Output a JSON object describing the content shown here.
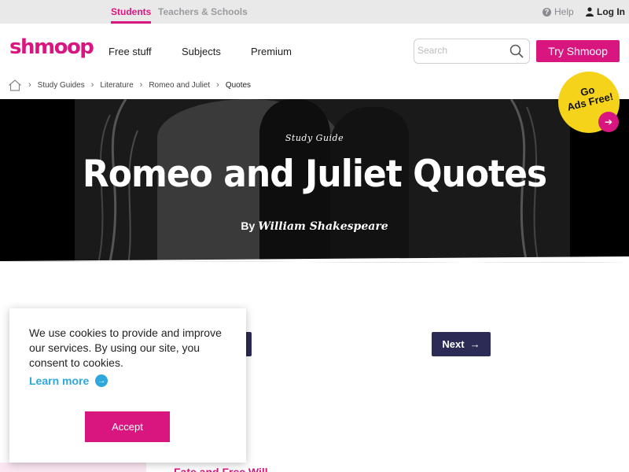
{
  "topbar": {
    "students_tab": "Students",
    "teachers_tab": "Teachers & Schools",
    "help": "Help",
    "login": "Log In"
  },
  "header": {
    "logo": "shmoop",
    "nav": [
      "Free stuff",
      "Subjects",
      "Premium"
    ],
    "search_placeholder": "Search",
    "try_button": "Try Shmoop"
  },
  "breadcrumb": {
    "items": [
      "Study Guides",
      "Literature",
      "Romeo and Juliet"
    ],
    "current": "Quotes"
  },
  "hero": {
    "eyebrow": "Study Guide",
    "title": "Romeo and Juliet Quotes",
    "by_prefix": "By",
    "author": "William Shakespeare"
  },
  "ads_badge": {
    "line1": "Go",
    "line2": "Ads Free!"
  },
  "pager": {
    "next_label": "Next"
  },
  "section": {
    "heading": "Fate and Free Will"
  },
  "cookie": {
    "message": "We use cookies to provide and improve our services. By using our site, you consent to cookies.",
    "learn_more": "Learn more",
    "accept": "Accept"
  },
  "colors": {
    "brand_pink": "#d9167f",
    "navy": "#2b2b55",
    "link_blue": "#2ea8dc",
    "badge_yellow": "#f5d31b"
  }
}
